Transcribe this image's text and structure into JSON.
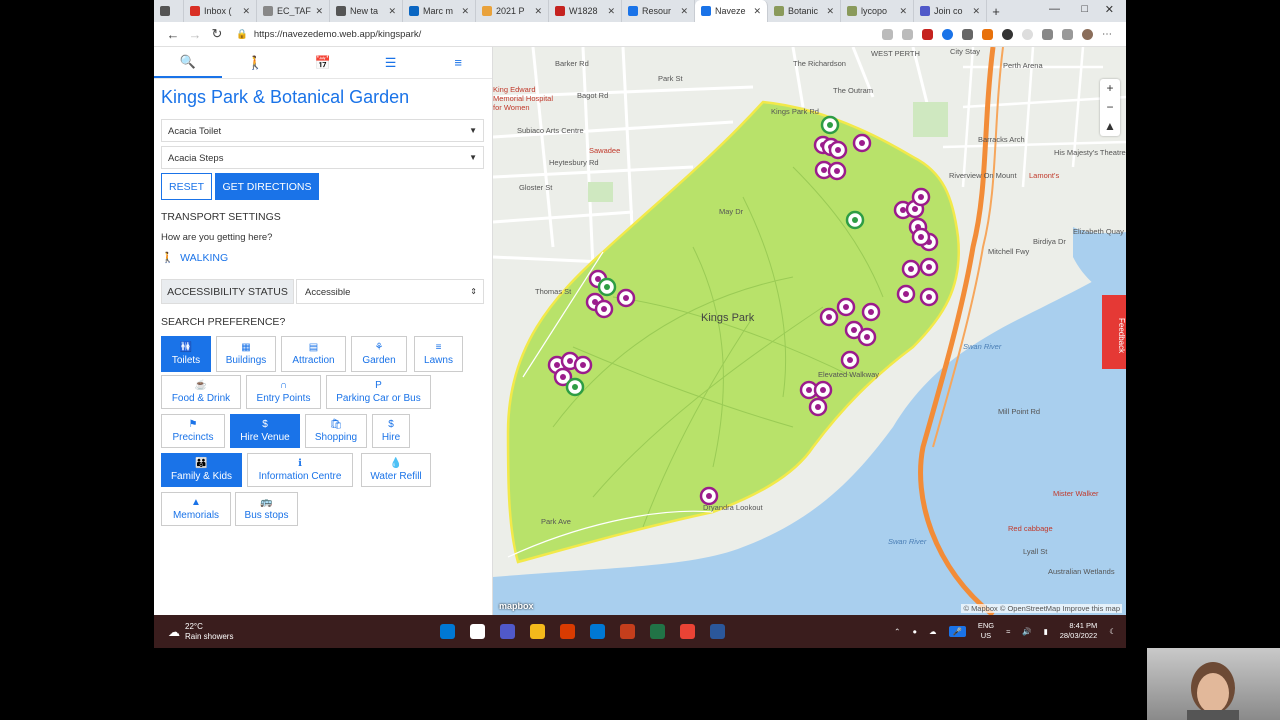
{
  "browser": {
    "tabs": [
      {
        "label": "Inbox (",
        "color": "#d93025",
        "active": false
      },
      {
        "label": "EC_TAF",
        "color": "#888888",
        "active": false
      },
      {
        "label": "New ta",
        "color": "#555555",
        "active": false
      },
      {
        "label": "Marc m",
        "color": "#0a66c2",
        "active": false
      },
      {
        "label": "2021 P",
        "color": "#e9a23b",
        "active": false
      },
      {
        "label": "W1828",
        "color": "#c5221f",
        "active": false
      },
      {
        "label": "Resour",
        "color": "#1a73e8",
        "active": false
      },
      {
        "label": "Naveze",
        "color": "#1a73e8",
        "active": true
      },
      {
        "label": "Botanic",
        "color": "#8a9a5b",
        "active": false
      },
      {
        "label": "lycopo",
        "color": "#8a9a5b",
        "active": false
      },
      {
        "label": "Join co",
        "color": "#5059c9",
        "active": false
      }
    ],
    "new_tab": "+",
    "url": "https://navezedemo.web.app/kingspark/",
    "window_controls": [
      "—",
      "□",
      "✕"
    ]
  },
  "panel": {
    "tabs": [
      {
        "icon": "search-icon",
        "glyph": "🔍"
      },
      {
        "icon": "walking-icon",
        "glyph": "🚶"
      },
      {
        "icon": "calendar-icon",
        "glyph": "📅"
      },
      {
        "icon": "layers-icon",
        "glyph": "☰"
      },
      {
        "icon": "menu-icon",
        "glyph": "≡"
      }
    ],
    "title": "Kings Park & Botanical Garden",
    "from_value": "Acacia Toilet",
    "to_value": "Acacia Steps",
    "reset_label": "RESET",
    "directions_label": "GET DIRECTIONS",
    "transport_heading": "TRANSPORT SETTINGS",
    "transport_question": "How are you getting here?",
    "transport_mode": "WALKING",
    "accessibility_label": "ACCESSIBILITY STATUS",
    "accessibility_value": "Accessible",
    "search_pref_heading": "SEARCH PREFERENCE?",
    "preferences": [
      {
        "label": "Toilets",
        "icon": "toilet-icon",
        "glyph": "🚻",
        "on": true
      },
      {
        "label": "Buildings",
        "icon": "building-icon",
        "glyph": "▦",
        "on": false
      },
      {
        "label": "Attraction",
        "icon": "attraction-icon",
        "glyph": "▤",
        "on": false
      },
      {
        "label": "Garden",
        "icon": "garden-icon",
        "glyph": "⚘",
        "on": false
      },
      {
        "label": "Lawns",
        "icon": "lawn-icon",
        "glyph": "≡",
        "on": false
      },
      {
        "label": "Food & Drink",
        "icon": "food-icon",
        "glyph": "☕",
        "on": false
      },
      {
        "label": "Entry Points",
        "icon": "entry-icon",
        "glyph": "∩",
        "on": false
      },
      {
        "label": "Parking Car or Bus",
        "icon": "parking-icon",
        "glyph": "P",
        "on": false
      },
      {
        "label": "Precincts",
        "icon": "precinct-icon",
        "glyph": "⚑",
        "on": false
      },
      {
        "label": "Hire Venue",
        "icon": "dollar-icon",
        "glyph": "$",
        "on": true
      },
      {
        "label": "Shopping",
        "icon": "shopping-icon",
        "glyph": "🛍",
        "on": false
      },
      {
        "label": "Hire",
        "icon": "hire-icon",
        "glyph": "$",
        "on": false
      },
      {
        "label": "Family & Kids",
        "icon": "family-icon",
        "glyph": "👪",
        "on": true
      },
      {
        "label": "Information Centre",
        "icon": "info-icon",
        "glyph": "ℹ",
        "on": false
      },
      {
        "label": "Water Refill",
        "icon": "water-icon",
        "glyph": "💧",
        "on": false
      },
      {
        "label": "Memorials",
        "icon": "memorial-icon",
        "glyph": "▲",
        "on": false
      },
      {
        "label": "Bus stops",
        "icon": "bus-icon",
        "glyph": "🚌",
        "on": false
      }
    ]
  },
  "map": {
    "park_label": "Kings Park",
    "labels": [
      {
        "text": "Barker Rd",
        "kind": "road"
      },
      {
        "text": "Park St",
        "kind": "road"
      },
      {
        "text": "Bagot Rd",
        "kind": "road"
      },
      {
        "text": "The Richardson",
        "kind": "road"
      },
      {
        "text": "WEST PERTH",
        "kind": "road"
      },
      {
        "text": "City Stay",
        "kind": "road"
      },
      {
        "text": "Perth Arena",
        "kind": "road"
      },
      {
        "text": "The Outram",
        "kind": "road"
      },
      {
        "text": "King Edward Memorial Hospital for Women",
        "kind": "red"
      },
      {
        "text": "Subiaco Arts Centre",
        "kind": "road"
      },
      {
        "text": "Sawadee",
        "kind": "red"
      },
      {
        "text": "Heytesbury Rd",
        "kind": "road"
      },
      {
        "text": "Gloster St",
        "kind": "road"
      },
      {
        "text": "Barracks Arch",
        "kind": "road"
      },
      {
        "text": "His Majesty's Theatre",
        "kind": "road"
      },
      {
        "text": "Riverview On Mount",
        "kind": "road"
      },
      {
        "text": "Lamont's",
        "kind": "red"
      },
      {
        "text": "Kings Park Rd",
        "kind": "road"
      },
      {
        "text": "May Dr",
        "kind": "road"
      },
      {
        "text": "Elizabeth Quay",
        "kind": "road"
      },
      {
        "text": "Mitchell Fwy",
        "kind": "road"
      },
      {
        "text": "Birdiya Dr",
        "kind": "road"
      },
      {
        "text": "Thomas St",
        "kind": "road"
      },
      {
        "text": "Swan River",
        "kind": "water"
      },
      {
        "text": "Elevated Walkway",
        "kind": "road"
      },
      {
        "text": "Park Ave",
        "kind": "road"
      },
      {
        "text": "Dryandra Lookout",
        "kind": "road"
      },
      {
        "text": "Mill Point Rd",
        "kind": "road"
      },
      {
        "text": "Mister Walker",
        "kind": "red"
      },
      {
        "text": "Red cabbage",
        "kind": "red"
      },
      {
        "text": "Lyall St",
        "kind": "road"
      },
      {
        "text": "Australian Wetlands",
        "kind": "road"
      },
      {
        "text": "Swan River",
        "kind": "water"
      }
    ],
    "zoom_in": "+",
    "zoom_out": "−",
    "compass": "▲",
    "feedback": "Feedback",
    "attribution": "© Mapbox © OpenStreetMap Improve this map",
    "logo": "mapbox"
  },
  "taskbar": {
    "temperature": "22°C",
    "weather": "Rain showers",
    "language": "ENG",
    "region": "US",
    "time": "8:41 PM",
    "date": "28/03/2022",
    "app_colors": [
      "#0078d4",
      "#ffffff",
      "#5059c9",
      "#f3b91b",
      "#d83b01",
      "#0078d4",
      "#c43e1c",
      "#217346",
      "#ea4335",
      "#2b579a"
    ]
  }
}
